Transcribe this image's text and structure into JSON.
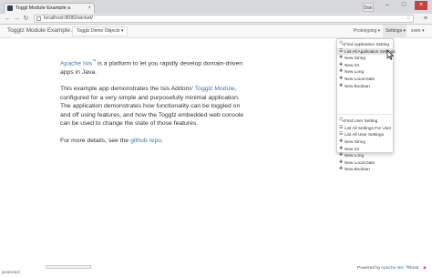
{
  "browser": {
    "tab_title": "Toggl Module Example a",
    "url": "localhost:8080/wicket/",
    "profile_label": "Dan",
    "tab_close": "×",
    "win_min": "–",
    "win_max": "□",
    "win_close": "×",
    "back_glyph": "←",
    "forward_glyph": "→",
    "reload_glyph": "↻",
    "star_glyph": "☆",
    "menu_glyph": "≡"
  },
  "navbar": {
    "brand": "Togglz Module Example App",
    "menu_label": "Togglz Demo Objects ▾",
    "prototyping": "Prototyping ▾",
    "settings": "Settings ▾",
    "user": "sven ▾"
  },
  "content": {
    "p1_link": "Apache Isis",
    "p1_trademark": "™",
    "p1_text": " is a platform to let you rapidly develop domain-driven apps in Java.",
    "p2_prefix": "This example app demonstrates the Isis Addons' ",
    "p2_link": "Togglz Module",
    "p2_text": ", configured for a very simple and purposefully minimal application. The application demonstrates how functionality can be toggled on and off using features, and how the Togglz embedded web console can be used to change the state of those features.",
    "p3_prefix": "For more details, see the ",
    "p3_link": "github repo",
    "p3_suffix": "."
  },
  "dropdown": {
    "app_settings": [
      {
        "icon": "🔍",
        "label": "Find Application Setting"
      },
      {
        "icon": "☰",
        "label": "List All Application Settings",
        "highlighted": true
      },
      {
        "icon": "✚",
        "label": "New String"
      },
      {
        "icon": "✚",
        "label": "New Int"
      },
      {
        "icon": "✚",
        "label": "New Long"
      },
      {
        "icon": "✚",
        "label": "New Local Date"
      },
      {
        "icon": "✚",
        "label": "New Boolean"
      }
    ],
    "user_settings": [
      {
        "icon": "🔍",
        "label": "Find User Setting"
      },
      {
        "icon": "☰",
        "label": "List All Settings For User"
      },
      {
        "icon": "☰",
        "label": "List All User Settings"
      },
      {
        "icon": "✚",
        "label": "New String"
      },
      {
        "icon": "✚",
        "label": "New Int"
      },
      {
        "icon": "✚",
        "label": "New Long"
      },
      {
        "icon": "✚",
        "label": "New Local Date"
      },
      {
        "icon": "✚",
        "label": "New Boolean"
      }
    ]
  },
  "status": {
    "left": "javascript:;"
  },
  "footer": {
    "powered_by": "Powered by",
    "isis": "Apache Isis ™",
    "about": "About",
    "warn_glyph": "▲"
  },
  "colors": {
    "link": "#337ab7",
    "window_close": "#c9413a",
    "highlight": "#e6e6e6"
  }
}
